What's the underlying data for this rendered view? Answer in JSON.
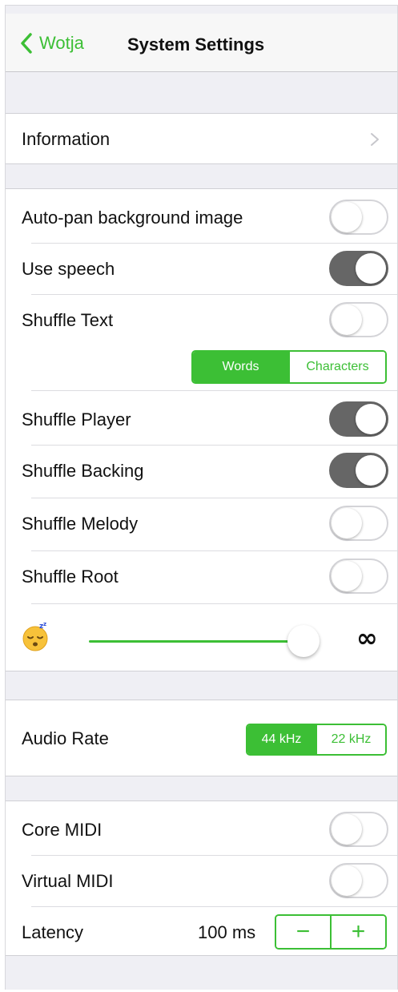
{
  "nav": {
    "back_label": "Wotja",
    "title": "System Settings"
  },
  "info": {
    "label": "Information"
  },
  "toggles": {
    "autopan": {
      "label": "Auto-pan background image",
      "on": false
    },
    "speech": {
      "label": "Use speech",
      "on": true
    },
    "shuffle_text": {
      "label": "Shuffle Text",
      "on": false
    },
    "shuffle_player": {
      "label": "Shuffle Player",
      "on": true
    },
    "shuffle_backing": {
      "label": "Shuffle Backing",
      "on": true
    },
    "shuffle_melody": {
      "label": "Shuffle Melody",
      "on": false
    },
    "shuffle_root": {
      "label": "Shuffle Root",
      "on": false
    }
  },
  "shuffle_text_mode": {
    "options": [
      "Words",
      "Characters"
    ],
    "selected": "Words"
  },
  "sleep_slider": {
    "min_icon": "sleeping-face-icon",
    "max_label": "∞",
    "value_fraction": 1.0
  },
  "audio_rate": {
    "label": "Audio Rate",
    "options": [
      "44 kHz",
      "22 kHz"
    ],
    "selected": "44 kHz"
  },
  "midi": {
    "core": {
      "label": "Core MIDI",
      "on": false
    },
    "virtual": {
      "label": "Virtual MIDI",
      "on": false
    }
  },
  "latency": {
    "label": "Latency",
    "value": "100 ms",
    "minus": "−",
    "plus": "+"
  },
  "colors": {
    "accent": "#3cbf35",
    "toggle_on": "#666666",
    "background": "#efeff4"
  }
}
